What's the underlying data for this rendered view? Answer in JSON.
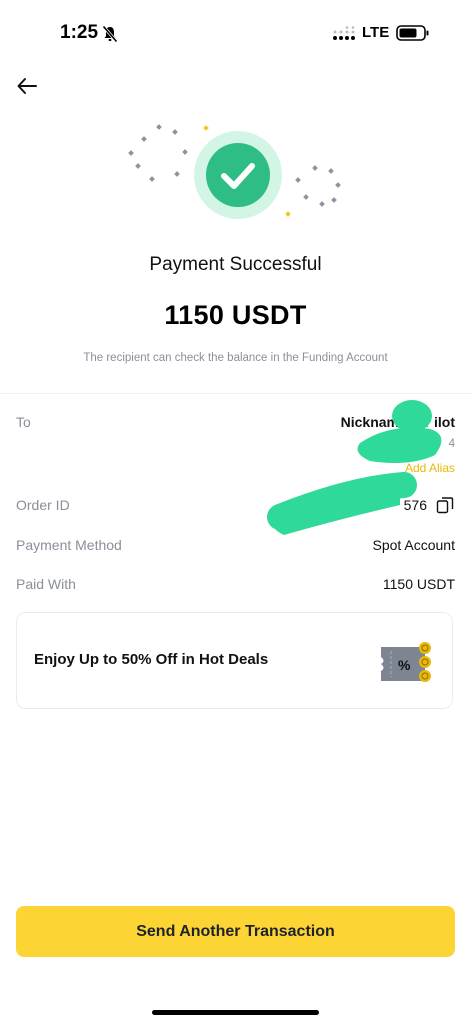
{
  "status_bar": {
    "time": "1:25",
    "network": "LTE"
  },
  "header": {
    "back_icon": "arrow-left-icon"
  },
  "result": {
    "title": "Payment Successful",
    "amount": "1150 USDT",
    "subtitle": "The recipient can check the balance in the Funding Account"
  },
  "details": {
    "to": {
      "label": "To",
      "value": "Nickname: Pr   ilot",
      "sub": "4",
      "alias": "Add Alias"
    },
    "order_id": {
      "label": "Order ID",
      "value": "576"
    },
    "payment_method": {
      "label": "Payment Method",
      "value": "Spot Account"
    },
    "paid_with": {
      "label": "Paid With",
      "value": "1150 USDT"
    }
  },
  "promo": {
    "text": "Enjoy Up to 50% Off in Hot Deals"
  },
  "cta": {
    "label": "Send Another Transaction"
  },
  "colors": {
    "accent": "#fcd535",
    "success": "#2ebd85",
    "muted": "#8a8f99",
    "alias": "#e8b90a",
    "redaction": "#2fd99a"
  }
}
